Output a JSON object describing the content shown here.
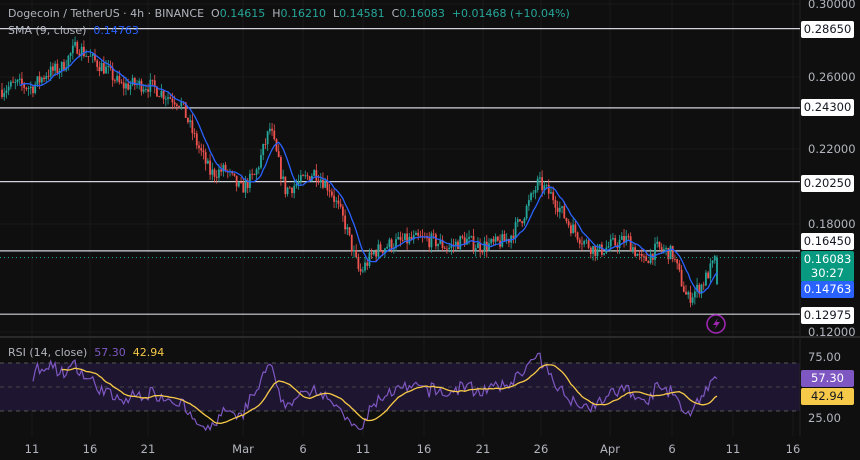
{
  "header": {
    "symbol": "Dogecoin / TetherUS · 4h · BINANCE",
    "o_label": "O",
    "o": "0.14615",
    "h_label": "H",
    "h": "0.16210",
    "l_label": "L",
    "l": "0.14581",
    "c_label": "C",
    "c": "0.16083",
    "change": "+0.01468 (+10.04%)"
  },
  "sma": {
    "label": "SMA (9, close)",
    "value": "0.14763"
  },
  "rsi": {
    "label": "RSI (14, close)",
    "value": "57.30",
    "ma_value": "42.94"
  },
  "price_axis": [
    "0.30000",
    "0.26000",
    "0.22000",
    "0.18000",
    "0.12000"
  ],
  "levels": [
    "0.28650",
    "0.24300",
    "0.20250",
    "0.16450",
    "0.12975"
  ],
  "current": {
    "price": "0.16083",
    "countdown": "30:27",
    "sma": "0.14763"
  },
  "rsi_axis": [
    "75.00",
    "25.00"
  ],
  "x_axis": [
    "11",
    "16",
    "21",
    "Mar",
    "6",
    "11",
    "16",
    "21",
    "26",
    "Apr",
    "6",
    "11",
    "16"
  ],
  "colors": {
    "up": "#26a69a",
    "down": "#ef5350",
    "sma": "#2962ff",
    "rsi": "#7e57c2",
    "rsi_ma": "#f7c948",
    "level": "#d1d4dc"
  },
  "chart_data": {
    "type": "candlestick",
    "title": "Dogecoin / TetherUS · 4h · BINANCE",
    "ylim": [
      0.115,
      0.3
    ],
    "rsi_ylim": [
      0,
      100
    ],
    "rsi_bands": [
      70,
      50,
      30
    ],
    "approx_close_path": [
      0.253,
      0.256,
      0.254,
      0.262,
      0.265,
      0.277,
      0.27,
      0.264,
      0.255,
      0.256,
      0.255,
      0.25,
      0.246,
      0.225,
      0.207,
      0.209,
      0.198,
      0.206,
      0.232,
      0.198,
      0.202,
      0.208,
      0.199,
      0.18,
      0.152,
      0.164,
      0.168,
      0.17,
      0.171,
      0.17,
      0.166,
      0.171,
      0.167,
      0.168,
      0.171,
      0.184,
      0.202,
      0.194,
      0.18,
      0.17,
      0.164,
      0.168,
      0.171,
      0.158,
      0.166,
      0.163,
      0.138,
      0.146,
      0.161
    ],
    "last_candle": {
      "open": 0.14615,
      "high": 0.1621,
      "low": 0.14581,
      "close": 0.16083
    },
    "horizontal_levels": [
      0.2865,
      0.243,
      0.2025,
      0.1645,
      0.12975
    ]
  }
}
